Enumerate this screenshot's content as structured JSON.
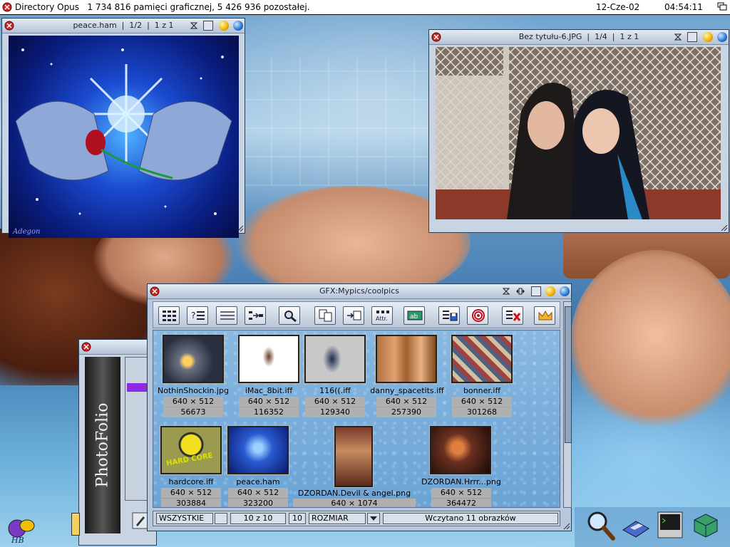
{
  "screen": {
    "title": "Directory Opus   1 734 816 pamięci graficznej, 5 426 936 pozostałej.",
    "date": "12-Cze-02",
    "time": "04:54:11"
  },
  "windows": {
    "peace": {
      "title": "peace.ham  |  1/2  |  1 z 1",
      "signature": "Adegon"
    },
    "bez": {
      "title": "Bez tytułu-6.JPG  |  1/4  |  1 z 1"
    },
    "lister": {
      "title": "GFX:Mypics/coolpics"
    },
    "photofolio": {
      "label": "PhotoFolio"
    }
  },
  "toolbar": [
    {
      "name": "view-grid-icon"
    },
    {
      "name": "info-list-icon"
    },
    {
      "name": "list-icon"
    },
    {
      "name": "select-arrow-icon"
    },
    {
      "name": "search-magnify-icon"
    },
    {
      "name": "copy-icon"
    },
    {
      "name": "move-icon"
    },
    {
      "name": "attributes-icon",
      "label": "Attr."
    },
    {
      "name": "rename-icon",
      "label": "ab"
    },
    {
      "name": "save-icon"
    },
    {
      "name": "target-icon"
    },
    {
      "name": "delete-icon"
    },
    {
      "name": "crown-icon"
    }
  ],
  "files": [
    {
      "name": "NothinShockin.jpg",
      "dims": "640 × 512",
      "size": "56673"
    },
    {
      "name": "iMac_8bit.iff",
      "dims": "640 × 512",
      "size": "116352"
    },
    {
      "name": "116((.iff",
      "dims": "640 × 512",
      "size": "129340"
    },
    {
      "name": "danny_spacetits.iff",
      "dims": "640 × 512",
      "size": "257390"
    },
    {
      "name": "bonner.iff",
      "dims": "640 × 512",
      "size": "301268"
    },
    {
      "name": "hardcore.iff",
      "dims": "640 × 512",
      "size": "303884"
    },
    {
      "name": "peace.ham",
      "dims": "640 × 512",
      "size": "323200"
    },
    {
      "name": "DZORDAN.Devil & angel.png",
      "dims": "640 × 1074",
      "size": ""
    },
    {
      "name": "DZORDAN.Hrrr...png",
      "dims": "640 × 512",
      "size": "364472"
    }
  ],
  "thumb_text": {
    "hardcore": "HARD CORE"
  },
  "status": {
    "filter": "WSZYSTKIE",
    "count": "10 z 10",
    "total": "10",
    "size_label": "ROZMIAR",
    "message": "Wczytano 11 obrazków"
  },
  "dock": [
    "magnifier-icon",
    "disk-icon",
    "shell-icon",
    "cube-icon"
  ],
  "logo_text": "HB"
}
